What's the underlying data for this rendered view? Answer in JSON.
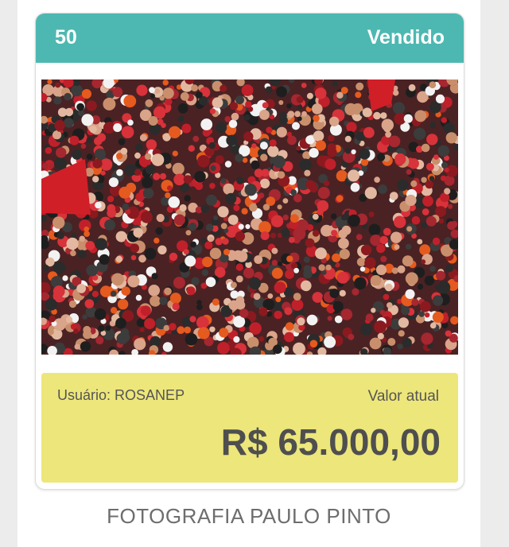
{
  "card": {
    "lot_number": "50",
    "status": "Vendido",
    "user_label": "Usuário:",
    "user_name": "ROSANEP",
    "current_value_label": "Valor atual",
    "price": "R$ 65.000,00",
    "photo_icon": "crowd-photo"
  },
  "caption": "FOTOGRAFIA PAULO PINTO",
  "colors": {
    "header_bg": "#4db8b1",
    "info_bg": "#ede67a",
    "text_dark": "#4f4f4f"
  }
}
